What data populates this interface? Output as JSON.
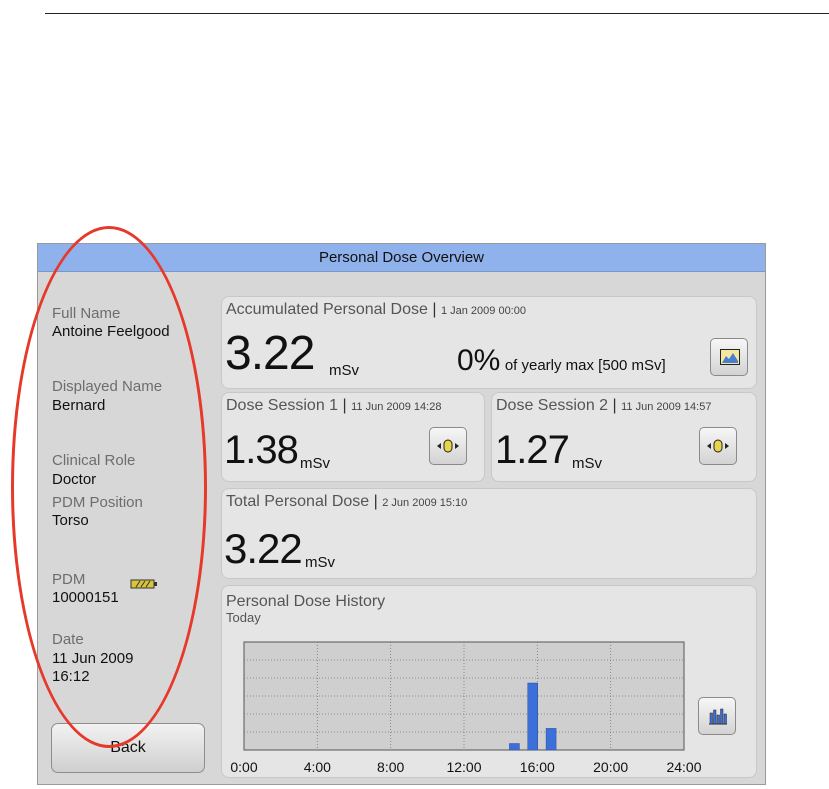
{
  "window": {
    "title": "Personal Dose Overview"
  },
  "sidebar": {
    "full_name_label": "Full Name",
    "full_name": "Antoine Feelgood",
    "displayed_name_label": "Displayed Name",
    "displayed_name": "Bernard",
    "clinical_role_label": "Clinical Role",
    "clinical_role": "Doctor",
    "pdm_position_label": "PDM Position",
    "pdm_position": "Torso",
    "pdm_label": "PDM",
    "pdm_id": "10000151",
    "date_label": "Date",
    "date": "11 Jun 2009",
    "time": "16:12",
    "back_label": "Back"
  },
  "accumulated": {
    "title": "Accumulated Personal Dose",
    "sep": "|",
    "date": "1 Jan 2009 00:00",
    "value": "3.22",
    "unit": "mSv",
    "percent": "0%",
    "percent_text": "of yearly max [500 mSv]"
  },
  "session1": {
    "title": "Dose Session 1",
    "sep": "|",
    "date": "11 Jun 2009 14:28",
    "value": "1.38",
    "unit": "mSv"
  },
  "session2": {
    "title": "Dose Session 2",
    "sep": "|",
    "date": "11 Jun 2009 14:57",
    "value": "1.27",
    "unit": "mSv"
  },
  "total": {
    "title": "Total Personal Dose",
    "sep": "|",
    "date": "2 Jun 2009 15:10",
    "value": "3.22",
    "unit": "mSv"
  },
  "history": {
    "title": "Personal Dose History",
    "subtitle": "Today"
  },
  "chart_data": {
    "type": "bar",
    "x_ticks": [
      "0:00",
      "4:00",
      "8:00",
      "12:00",
      "16:00",
      "20:00",
      "24:00"
    ],
    "xlim": [
      0,
      24
    ],
    "ylim": [
      0,
      100
    ],
    "bars": [
      {
        "x": 14.75,
        "value": 6
      },
      {
        "x": 15.75,
        "value": 62
      },
      {
        "x": 16.75,
        "value": 20
      }
    ],
    "grid": true,
    "bar_color": "#3c6fd8"
  },
  "icons": {
    "graph": "area-chart-icon",
    "session": "pdm-device-icon",
    "history": "bar-chart-icon",
    "battery": "battery-icon"
  }
}
